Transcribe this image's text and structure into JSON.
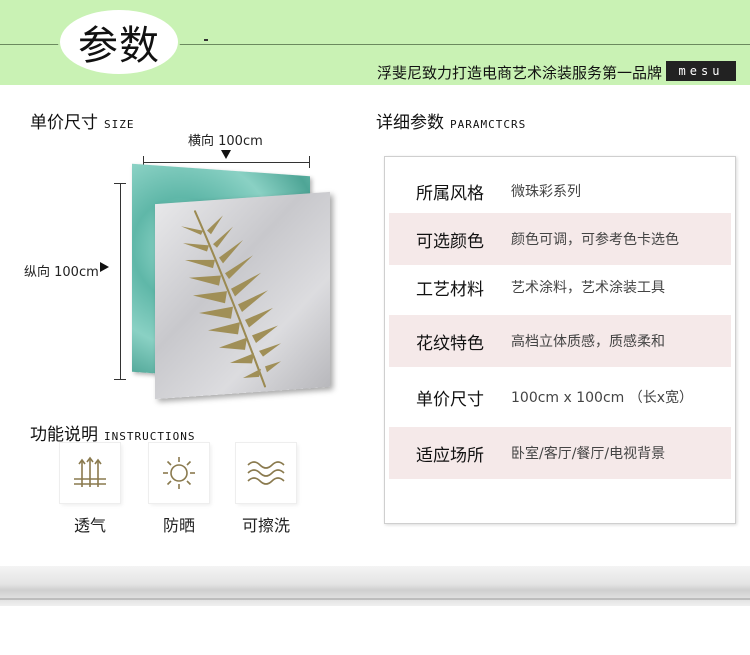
{
  "header": {
    "title": "参数",
    "slogan": "浮斐尼致力打造电商艺术涂装服务第一品牌",
    "brand": "mesu"
  },
  "size_section": {
    "title": "单价尺寸",
    "title_en": "SIZE",
    "horizontal_label": "横向 100cm",
    "vertical_label": "纵向 100cm"
  },
  "function_section": {
    "title": "功能说明",
    "title_en": "INSTRUCTIONS",
    "items": [
      {
        "label": "透气",
        "icon": "breathable-icon"
      },
      {
        "label": "防晒",
        "icon": "sun-icon"
      },
      {
        "label": "可擦洗",
        "icon": "washable-icon"
      }
    ]
  },
  "params_section": {
    "title": "详细参数",
    "title_en": "PARAMCTCRS",
    "rows": [
      {
        "key": "所属风格",
        "value": "微珠彩系列"
      },
      {
        "key": "可选颜色",
        "value": "颜色可调，可参考色卡选色"
      },
      {
        "key": "工艺材料",
        "value": "艺术涂料，艺术涂装工具"
      },
      {
        "key": "花纹特色",
        "value": "高档立体质感，质感柔和"
      },
      {
        "key": "单价尺寸",
        "value": "100cm x 100cm （长x宽）"
      },
      {
        "key": "适应场所",
        "value": "卧室/客厅/餐厅/电视背景"
      }
    ]
  },
  "colors": {
    "header_green": "#c9f2b4",
    "row_alt": "#f5e9e9",
    "icon_gold": "#8a7a4e"
  }
}
